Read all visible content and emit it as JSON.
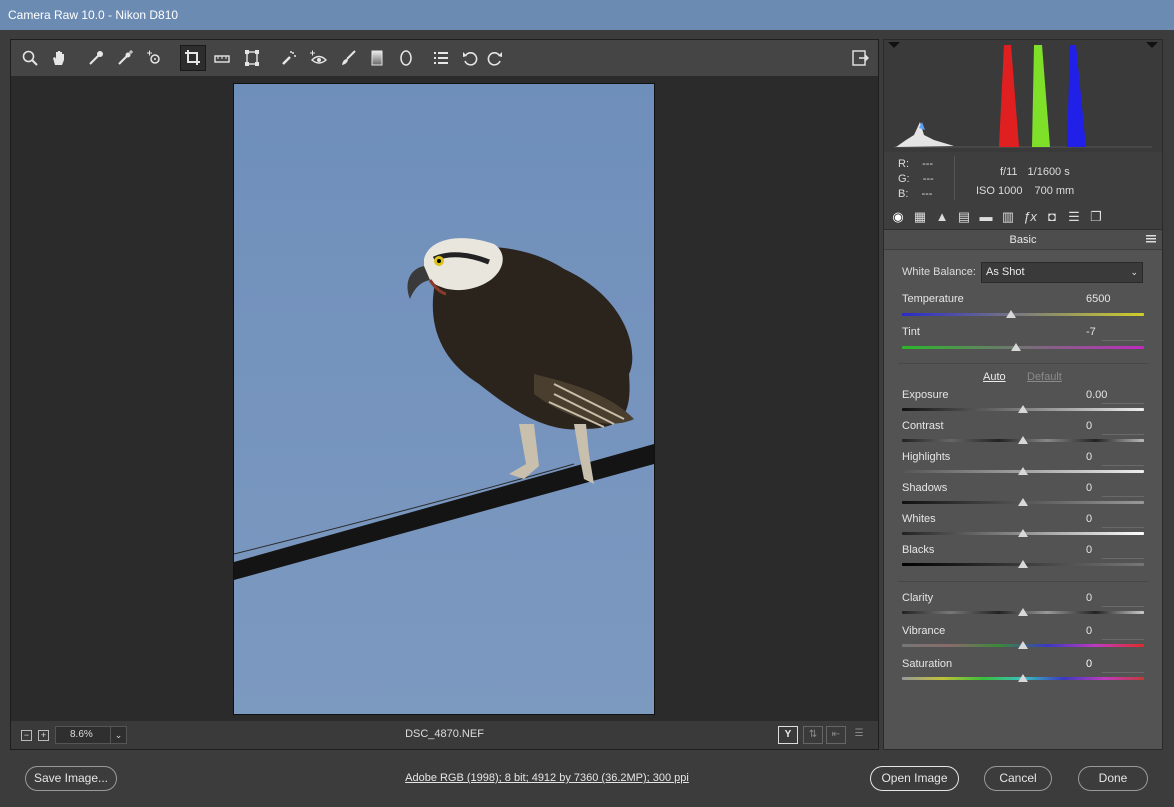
{
  "window": {
    "title": "Camera Raw 10.0  -  Nikon D810"
  },
  "toolbar": {
    "tools": [
      "zoom-tool",
      "hand-tool",
      "white-balance-tool",
      "color-sampler-tool",
      "targeted-adjustment-tool",
      "crop-tool",
      "straighten-tool",
      "transform-tool",
      "spot-removal-tool",
      "red-eye-tool",
      "adjustment-brush-tool",
      "graduated-filter-tool",
      "radial-filter-tool",
      "preferences-tool",
      "rotate-left-tool",
      "rotate-right-tool"
    ],
    "active_tool": "crop-tool"
  },
  "status": {
    "zoom_out": "−",
    "zoom_in": "+",
    "zoom": "8.6%",
    "filename": "DSC_4870.NEF",
    "view_label": "Y"
  },
  "info": {
    "r_label": "R:",
    "r_value": "---",
    "g_label": "G:",
    "g_value": "---",
    "b_label": "B:",
    "b_value": "---",
    "aperture": "f/11",
    "shutter": "1/1600 s",
    "iso": "ISO 1000",
    "focal_length": "700 mm"
  },
  "panel": {
    "title": "Basic",
    "white_balance": {
      "label": "White Balance:",
      "value": "As Shot"
    },
    "auto_label": "Auto",
    "default_label": "Default",
    "sliders": [
      {
        "label": "Temperature",
        "value": "6500",
        "level": 0.45
      },
      {
        "label": "Tint",
        "value": "-7",
        "level": 0.47
      },
      {
        "label": "Exposure",
        "value": "0.00",
        "level": 0.5
      },
      {
        "label": "Contrast",
        "value": "0",
        "level": 0.5
      },
      {
        "label": "Highlights",
        "value": "0",
        "level": 0.5
      },
      {
        "label": "Shadows",
        "value": "0",
        "level": 0.5
      },
      {
        "label": "Whites",
        "value": "0",
        "level": 0.5
      },
      {
        "label": "Blacks",
        "value": "0",
        "level": 0.5
      },
      {
        "label": "Clarity",
        "value": "0",
        "level": 0.5
      },
      {
        "label": "Vibrance",
        "value": "0",
        "level": 0.5
      },
      {
        "label": "Saturation",
        "value": "0",
        "level": 0.5
      }
    ]
  },
  "footer": {
    "save_label": "Save Image...",
    "workflow_text": "Adobe RGB (1998); 8 bit; 4912 by 7360 (36.2MP); 300 ppi",
    "open_label": "Open Image",
    "cancel_label": "Cancel",
    "done_label": "Done"
  },
  "colors": {
    "titlebar": "#6b8bb3",
    "sky": "#7593bd",
    "histogram_red": "#e02020",
    "histogram_green": "#7fe02a",
    "histogram_blue": "#2020e8"
  }
}
